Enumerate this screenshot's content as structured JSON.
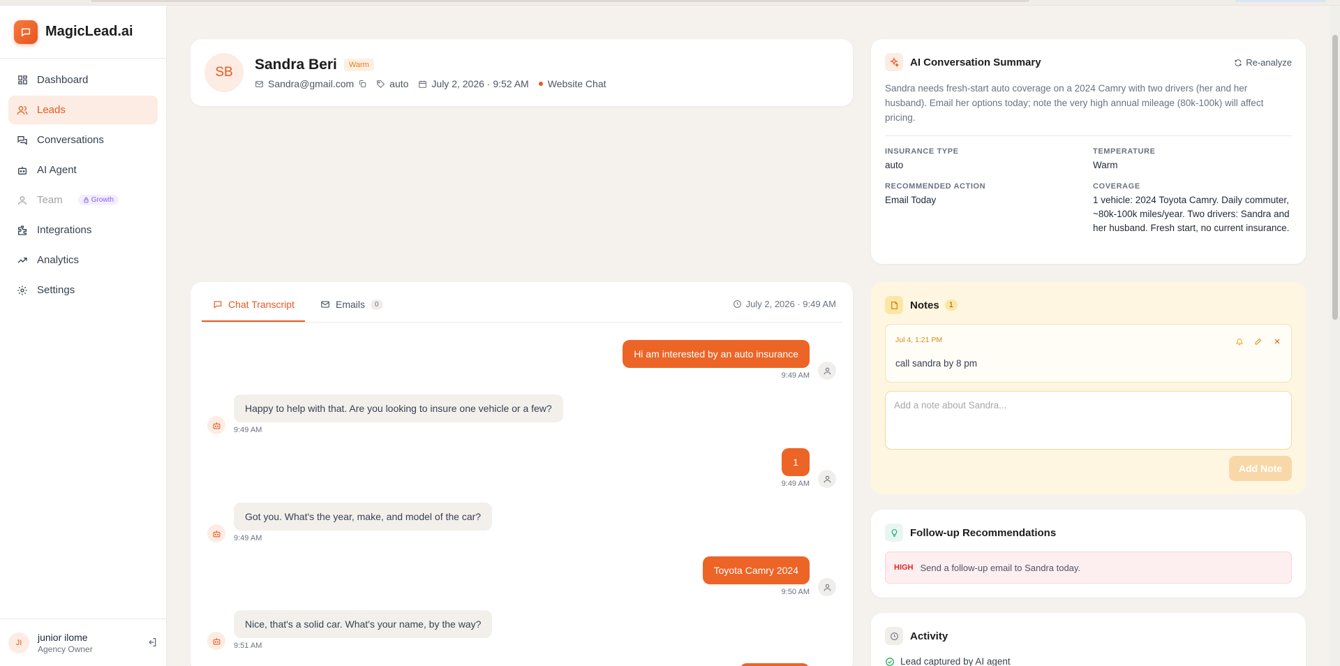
{
  "brand": {
    "name": "MagicLead.ai"
  },
  "sidebar": {
    "items": [
      {
        "label": "Dashboard",
        "icon": "dashboard-icon"
      },
      {
        "label": "Leads",
        "icon": "users-icon",
        "active": true
      },
      {
        "label": "Conversations",
        "icon": "chat-icon"
      },
      {
        "label": "AI Agent",
        "icon": "robot-icon"
      },
      {
        "label": "Team",
        "icon": "user-icon",
        "disabled": true,
        "badge": "Growth"
      },
      {
        "label": "Integrations",
        "icon": "puzzle-icon"
      },
      {
        "label": "Analytics",
        "icon": "trend-icon"
      },
      {
        "label": "Settings",
        "icon": "gear-icon"
      }
    ],
    "user": {
      "initials": "JI",
      "name": "junior ilome",
      "role": "Agency Owner"
    }
  },
  "lead": {
    "initials": "SB",
    "name": "Sandra Beri",
    "temperature_badge": "Warm",
    "email": "Sandra@gmail.com",
    "tag": "auto",
    "date": "July 2, 2026 · 9:52 AM",
    "source": "Website Chat"
  },
  "chat": {
    "tab_transcript": "Chat Transcript",
    "tab_emails": "Emails",
    "emails_count": "0",
    "date": "July 2, 2026 · 9:49 AM",
    "messages": [
      {
        "from": "user",
        "text": "Hi am interested by an auto insurance",
        "time": "9:49 AM"
      },
      {
        "from": "bot",
        "text": "Happy to help with that. Are you looking to insure one vehicle or a few?",
        "time": "9:49 AM"
      },
      {
        "from": "user",
        "text": "1",
        "time": "9:49 AM"
      },
      {
        "from": "bot",
        "text": "Got you. What's the year, make, and model of the car?",
        "time": "9:49 AM"
      },
      {
        "from": "user",
        "text": "Toyota Camry 2024",
        "time": "9:50 AM"
      },
      {
        "from": "bot",
        "text": "Nice, that's a solid car. What's your name, by the way?",
        "time": "9:51 AM"
      }
    ]
  },
  "summary": {
    "title": "AI Conversation Summary",
    "reanalyze_label": "Re-analyze",
    "text": "Sandra needs fresh-start auto coverage on a 2024 Camry with two drivers (her and her husband). Email her options today; note the very high annual mileage (80k-100k) will affect pricing.",
    "insurance_type_label": "INSURANCE TYPE",
    "insurance_type": "auto",
    "temperature_label": "TEMPERATURE",
    "temperature": "Warm",
    "action_label": "RECOMMENDED ACTION",
    "action": "Email Today",
    "coverage_label": "COVERAGE",
    "coverage": "1 vehicle: 2024 Toyota Camry. Daily commuter, ~80k-100k miles/year. Two drivers: Sandra and her husband. Fresh start, no current insurance."
  },
  "notes": {
    "title": "Notes",
    "count": "1",
    "items": [
      {
        "date": "Jul 4, 1:21 PM",
        "text": "call sandra by 8 pm"
      }
    ],
    "placeholder": "Add a note about Sandra...",
    "add_label": "Add Note"
  },
  "followup": {
    "title": "Follow-up Recommendations",
    "priority": "HIGH",
    "text": "Send a follow-up email to Sandra today."
  },
  "activity": {
    "title": "Activity",
    "items": [
      "Lead captured by AI agent"
    ]
  },
  "colors": {
    "accent": "#e8591f",
    "notes_bg": "#fef6e0",
    "high": "#dc2626"
  }
}
